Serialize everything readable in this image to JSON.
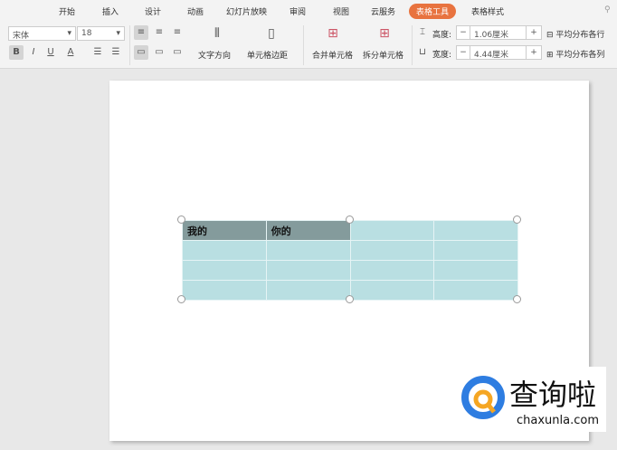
{
  "tabs": [
    "开始",
    "插入",
    "设计",
    "动画",
    "幻灯片放映",
    "审阅",
    "视图",
    "云服务",
    "表格工具",
    "表格样式"
  ],
  "active_tab": "表格工具",
  "accent": "#e8733f",
  "font": {
    "name": "宋体",
    "size": "18"
  },
  "format_buttons": {
    "bold": "B",
    "italic": "I",
    "underline": "U",
    "color": "A"
  },
  "text_direction": "文字方向",
  "cell_margin": "单元格边距",
  "merge": "合并单元格",
  "split": "拆分单元格",
  "height": {
    "label": "高度:",
    "value": "1.06厘米"
  },
  "width": {
    "label": "宽度:",
    "value": "4.44厘米"
  },
  "stepper": {
    "minus": "−",
    "plus": "+"
  },
  "distribute_rows": "平均分布各行",
  "distribute_cols": "平均分布各列",
  "table": {
    "rows": [
      [
        "我的",
        "你的",
        "",
        ""
      ],
      [
        "",
        "",
        "",
        ""
      ],
      [
        "",
        "",
        "",
        ""
      ],
      [
        "",
        "",
        "",
        ""
      ]
    ]
  },
  "watermark": {
    "text": "查询啦",
    "url": "chaxunla.com"
  }
}
